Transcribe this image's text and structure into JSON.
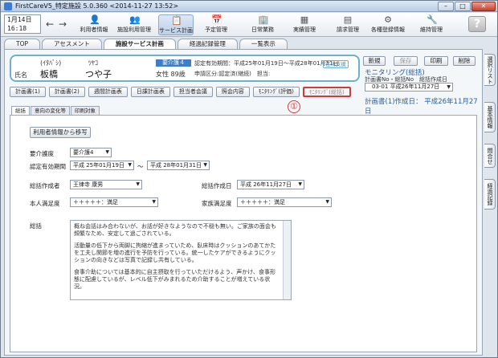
{
  "window": {
    "title": "FirstCareV5_特定施設 5.0.360 <2014-11-27 13:52>"
  },
  "toolbar": {
    "date_line1": "1月14日",
    "date_line2": "16:18",
    "tools": [
      {
        "label": "利用者情報"
      },
      {
        "label": "施設利用管理"
      },
      {
        "label": "サービス計画"
      },
      {
        "label": "予定管理"
      },
      {
        "label": "日常業務"
      },
      {
        "label": "実績管理"
      },
      {
        "label": "請求管理"
      },
      {
        "label": "各種登録情報"
      },
      {
        "label": "維持管理"
      }
    ],
    "help": "?"
  },
  "tabs": [
    "TOP",
    "アセスメント",
    "施設サービス計画",
    "経過記録管理",
    "一覧表示"
  ],
  "resident": {
    "kana_last": "(ｲﾀﾊﾞｼ)",
    "kana_first": "ﾂﾔｺ",
    "name_label": "氏名",
    "last_name": "板橋",
    "first_name": "つや子",
    "care_level": "要介護４",
    "gender_age": "女性 89歳",
    "certification_label": "認定有効期間：平成25年01月19日〜平成28年01月31日",
    "insurer_label": "申請区分:認定済(継続)　担当:",
    "status": "在所支援"
  },
  "actions": {
    "new": "新規",
    "save": "保存",
    "print": "印刷",
    "delete": "削除"
  },
  "plan": {
    "title": "モニタリング(総括)",
    "no_label": "計画書No・総括No　総括作成日",
    "selected": "03-01 平成26年11月27日",
    "created": "計画書(1)作成日： 平成26年11月27日"
  },
  "subtabs": [
    "計画書(1)",
    "計画書(2)",
    "週間計画表",
    "日課計画表",
    "担当者会議",
    "照会内容",
    "ﾓﾆﾀﾘﾝｸﾞ(評価)",
    "ﾓﾆﾀﾘﾝｸﾞ(総括)"
  ],
  "callout": "①",
  "content_tabs": [
    "総括",
    "意向の変化等",
    "印刷対象"
  ],
  "form": {
    "copy_button": "利用者情報から移写",
    "care_level_label": "要介護度",
    "care_level_value": "要介護4",
    "period_label": "認定有効期間",
    "period_from": "平成 25年01月19日",
    "period_sep": "〜",
    "period_to": "平成 28年01月31日",
    "author_label": "総括作成者",
    "author_value": "王律寺 康男",
    "created_label": "総括作成日",
    "created_value": "平成 26年11月27日",
    "self_sat_label": "本人満足度",
    "self_sat_value": "＋＋＋＋＋：満足",
    "family_sat_label": "家族満足度",
    "family_sat_value": "＋＋＋＋＋：満足",
    "summary_label": "総括",
    "summary_paragraphs": [
      "概ね会話はみ合わないが、お話が好きなようなので不穏も無い。ご家族の面会も頻繁なため、安定して過ごされている。",
      "活動量の低下から両脚に拘縮が進まっていため、臥床時はクッションのあてかたを工夫し関節を増の進行を予防を行っている。統一したケアができるようにクッションの向きなどは写真で記録し共有している。",
      "食事介助については基本的に自主摂取を行っていただけるよう、声かけ、食事形態に配慮しているが、レベル低下がみまれるため介助することが増えている状況。"
    ]
  },
  "sidetabs": [
    "選択リスト",
    "基本情報",
    "問合せ",
    "経過記録"
  ]
}
